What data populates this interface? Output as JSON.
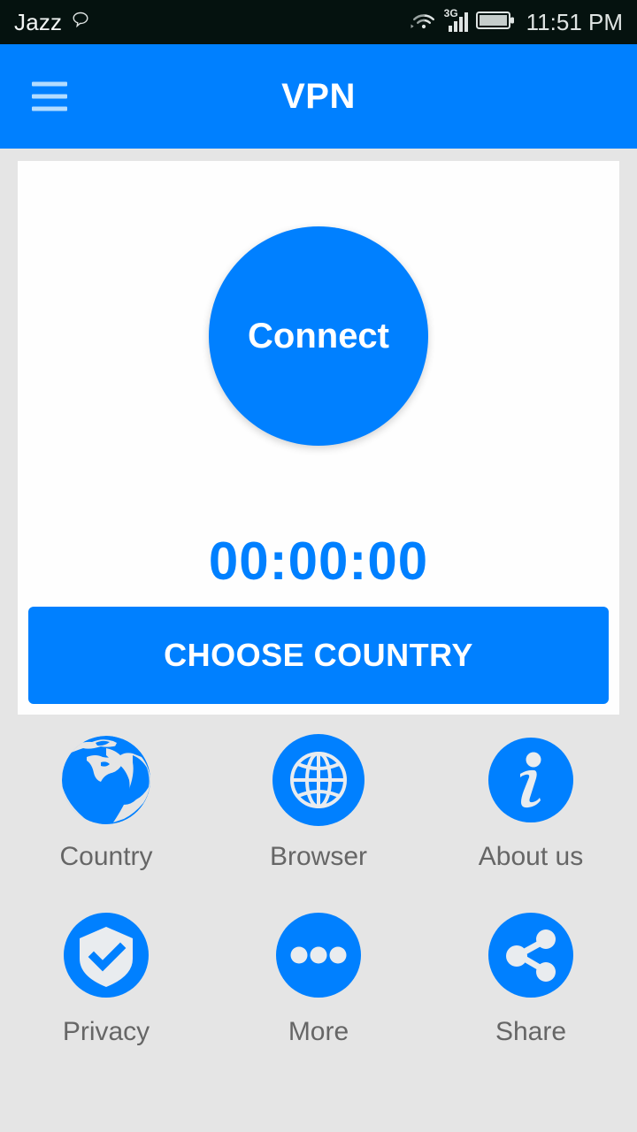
{
  "status_bar": {
    "carrier": "Jazz",
    "message_icon": "message-bubble-icon",
    "wifi_icon": "wifi-icon",
    "network_type": "3G",
    "signal_icon": "signal-bars-icon",
    "battery_icon": "battery-icon",
    "time": "11:51 PM"
  },
  "app_bar": {
    "menu_icon": "hamburger-menu-icon",
    "title": "VPN"
  },
  "main": {
    "connect_label": "Connect",
    "timer": "00:00:00",
    "choose_country_label": "CHOOSE COUNTRY"
  },
  "grid": {
    "items": [
      {
        "label": "Country",
        "icon": "earth-globe-icon"
      },
      {
        "label": "Browser",
        "icon": "globe-wireframe-icon"
      },
      {
        "label": "About us",
        "icon": "info-icon"
      },
      {
        "label": "Privacy",
        "icon": "shield-check-icon"
      },
      {
        "label": "More",
        "icon": "ellipsis-icon"
      },
      {
        "label": "Share",
        "icon": "share-nodes-icon"
      }
    ]
  },
  "colors": {
    "accent": "#0080ff",
    "status_bar_bg": "#05120f",
    "page_bg": "#e5e5e5",
    "card_bg": "#fefefe",
    "label_gray": "#666666",
    "menu_icon": "#b3dcff"
  }
}
